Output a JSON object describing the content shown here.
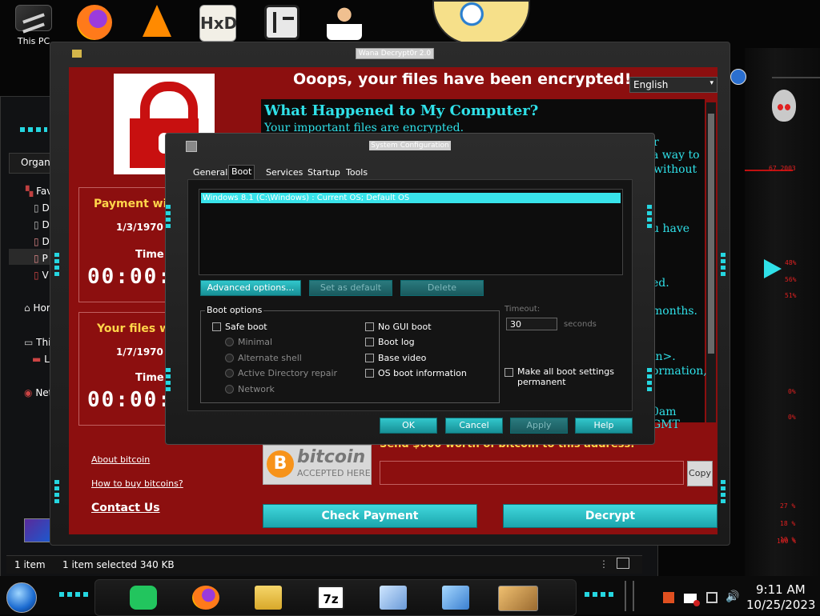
{
  "desktop": {
    "icons": [
      {
        "label": "This PC",
        "icon": "this-pc-icon"
      },
      {
        "label": "",
        "icon": "firefox-icon"
      },
      {
        "label": "",
        "icon": "vlc-icon"
      },
      {
        "label": "",
        "icon": "hxd-icon"
      },
      {
        "label": "",
        "icon": "maze-app-icon"
      },
      {
        "label": "",
        "icon": "doctor-icon"
      }
    ]
  },
  "explorer": {
    "organize": "Organiz",
    "nav_items": [
      "Fav",
      "D",
      "D",
      "D",
      "P",
      "V",
      "Hor",
      "This",
      "Lo",
      "Net"
    ],
    "status": {
      "items": "1 item",
      "selected": "1 item selected  340 KB"
    }
  },
  "wanna": {
    "title": "Wana Decrypt0r 2.0",
    "headline": "Ooops, your files have been encrypted!",
    "language": "English",
    "box1": {
      "label": "Payment will l",
      "date": "1/3/1970 16",
      "time_label": "Time L",
      "timer": "00:00:0"
    },
    "box2": {
      "label": "Your files wil",
      "date": "1/7/1970 16",
      "time_label": "Time l",
      "timer": "00:00:"
    },
    "links": {
      "about": "About bitcoin",
      "howto": "How to buy bitcoins?",
      "contact": "Contact Us"
    },
    "text": {
      "heading": "What Happened to My Computer?",
      "line1": "Your important files are encrypted.",
      "frag_r": "r",
      "frag_way": "a way to",
      "frag_without": "without",
      "frag_have": "u have",
      "frag_ed": "ed.",
      "frag_dot": ".",
      "frag_months": "months.",
      "frag_in": "in>.",
      "frag_ormation": "ormation,",
      "frag_gmt": "0am GMT"
    },
    "bitcoin": {
      "brand": "bitcoin",
      "accepted": "ACCEPTED HERE",
      "send": "Send $600 worth of bitcoin to this address:",
      "copy": "Copy"
    },
    "buttons": {
      "check": "Check Payment",
      "decrypt": "Decrypt"
    }
  },
  "sysconfig": {
    "title": "System Configuration",
    "tabs": [
      "General",
      "Boot",
      "Services",
      "Startup",
      "Tools"
    ],
    "active_tab": "Boot",
    "boot_entry": "Windows 8.1 (C:\\Windows) : Current OS; Default OS",
    "buttons": {
      "advanced": "Advanced options...",
      "set_default": "Set as default",
      "delete": "Delete"
    },
    "boot_options_label": "Boot options",
    "left_options": [
      {
        "label": "Safe boot",
        "type": "checkbox",
        "enabled": true
      },
      {
        "label": "Minimal",
        "type": "radio",
        "enabled": false
      },
      {
        "label": "Alternate shell",
        "type": "radio",
        "enabled": false
      },
      {
        "label": "Active Directory repair",
        "type": "radio",
        "enabled": false
      },
      {
        "label": "Network",
        "type": "radio",
        "enabled": false
      }
    ],
    "right_options": [
      {
        "label": "No GUI boot"
      },
      {
        "label": "Boot log"
      },
      {
        "label": "Base video"
      },
      {
        "label": "OS boot information"
      }
    ],
    "timeout_label": "Timeout:",
    "timeout_value": "30",
    "seconds_label": "seconds",
    "make_permanent": "Make all boot settings permanent",
    "dialog_buttons": {
      "ok": "OK",
      "cancel": "Cancel",
      "apply": "Apply",
      "help": "Help"
    }
  },
  "alien_panel": {
    "readouts": [
      "48%",
      "56%",
      "51%",
      "0%",
      "0%",
      "27 %",
      "18 %",
      "10 %",
      "100 %"
    ]
  },
  "taskbar": {
    "icons": [
      "start-orb-icon",
      "notes-app-icon",
      "firefox-icon",
      "file-explorer-icon",
      "7zip-icon",
      "system-monitor-icon",
      "image-viewer-icon",
      "handshake-icon"
    ],
    "tray_icons": [
      "lang-icon",
      "flag-icon",
      "network-icon",
      "volume-icon"
    ],
    "time": "9:11 AM",
    "date": "10/25/2023"
  },
  "colors": {
    "ransom_red": "#8c0f0f",
    "accent_cyan": "#2fe0e8",
    "button_teal": "#1ba6ad",
    "alien_red": "#c01010"
  }
}
